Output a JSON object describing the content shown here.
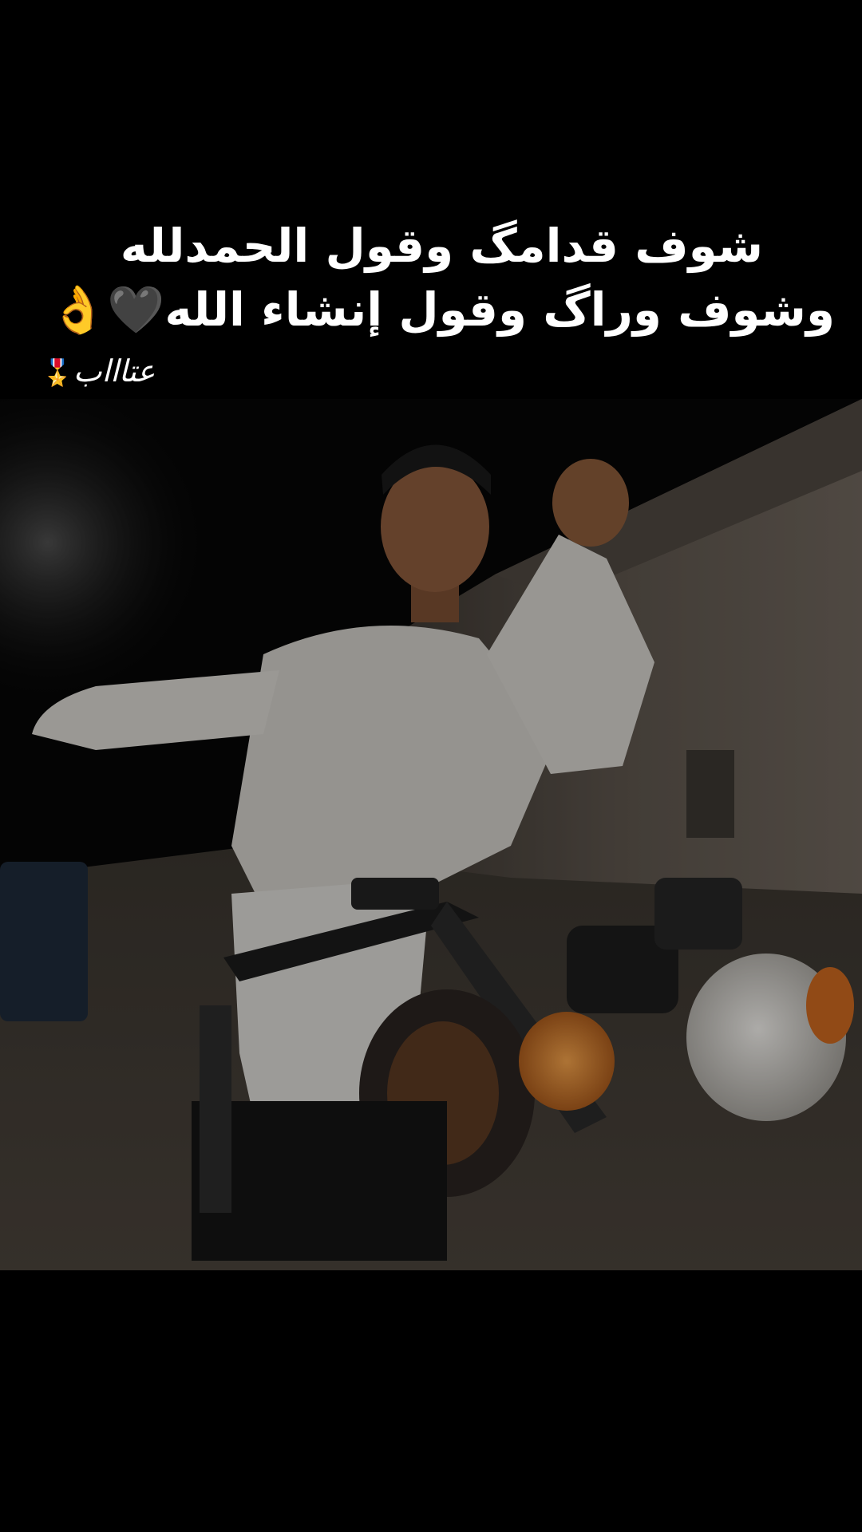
{
  "caption": {
    "line1": "شوف قدامگ وقول الحمدلله",
    "line2": "وشوف وراگ وقول إنشاء الله",
    "line2_emoji": "🖤👌"
  },
  "signature": {
    "text": "عتاااب",
    "medal": "🎖️"
  },
  "photo": {
    "description_icon": "photo-man-on-motorcycle",
    "colors": {
      "background": "#000000",
      "wall": "#6e655c",
      "robe": "#d9d7d3",
      "headlight": "#d8d5cf",
      "indicator": "#d37a2a"
    }
  }
}
